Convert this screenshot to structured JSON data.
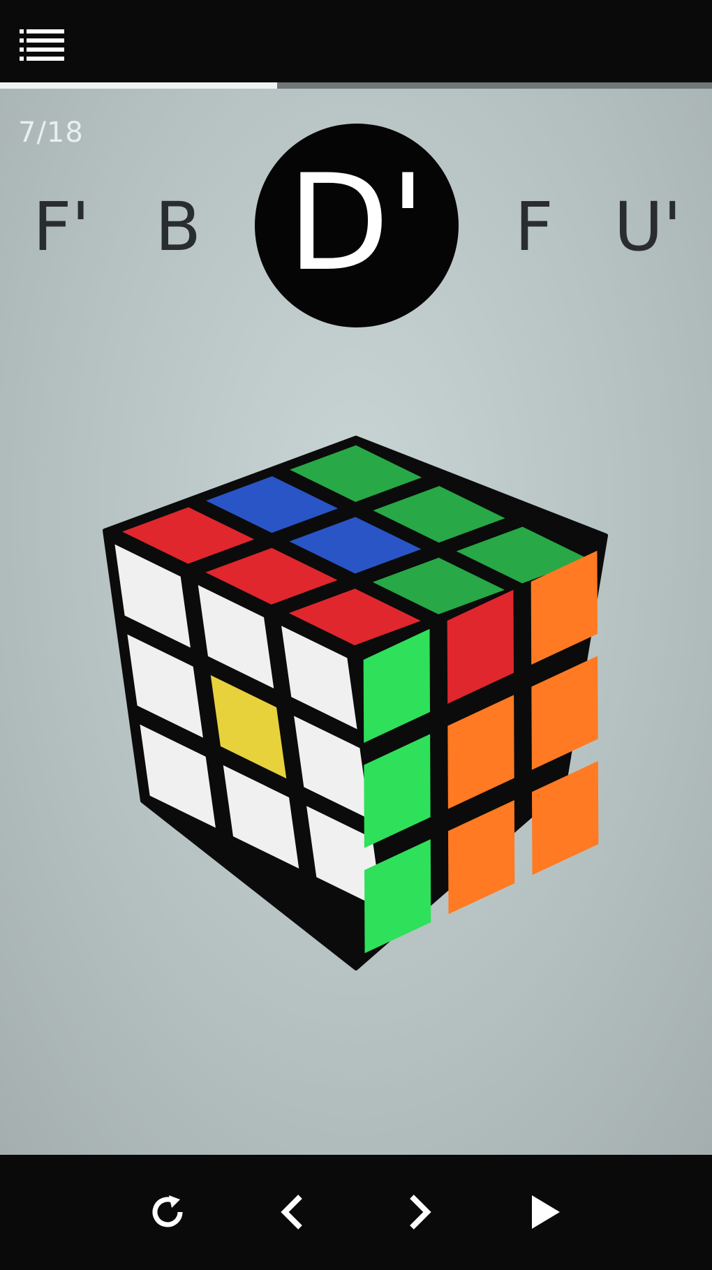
{
  "header": {
    "menu_icon": "list-menu-icon"
  },
  "progress": {
    "step": 7,
    "total": 18,
    "fraction": 0.389,
    "counter_text": "7/18"
  },
  "moves": {
    "prev_2": "F'",
    "prev_1": "B",
    "current": "D'",
    "next_1": "F",
    "next_2": "U'"
  },
  "cube": {
    "top": [
      [
        "red",
        "blue",
        "green"
      ],
      [
        "red",
        "blue",
        "green"
      ],
      [
        "red",
        "green",
        "green"
      ]
    ],
    "left": [
      [
        "white",
        "white",
        "white"
      ],
      [
        "white",
        "yellow",
        "white"
      ],
      [
        "white",
        "white",
        "white"
      ]
    ],
    "right": [
      [
        "green",
        "red",
        "orange"
      ],
      [
        "green",
        "orange",
        "orange"
      ],
      [
        "green",
        "orange",
        "orange"
      ]
    ],
    "colors": {
      "red": "#e0272d",
      "blue": "#2a55c7",
      "green": "#28a846",
      "bright_green": "#2fe05a",
      "white": "#f0f0f0",
      "yellow": "#e8d23c",
      "orange": "#ff7a22",
      "frame": "#0b0b0b"
    }
  },
  "controls": {
    "reset_icon": "reset-icon",
    "prev_icon": "chevron-left-icon",
    "next_icon": "chevron-right-icon",
    "play_icon": "play-icon"
  }
}
